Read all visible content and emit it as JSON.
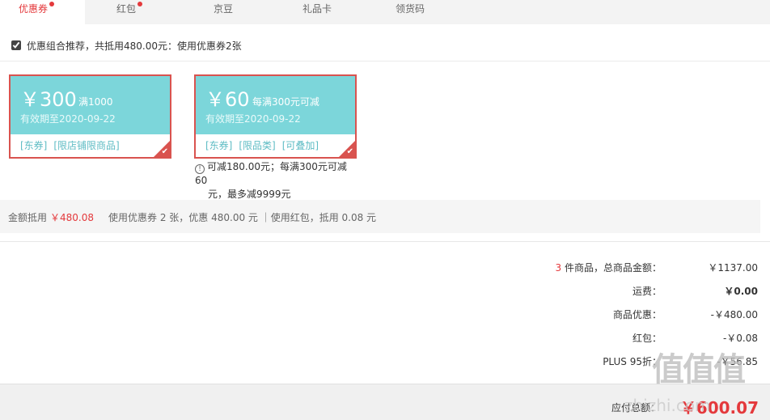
{
  "tabs": [
    {
      "label": "优惠券",
      "active": true,
      "dot": true
    },
    {
      "label": "红包",
      "active": false,
      "dot": true
    },
    {
      "label": "京豆",
      "active": false,
      "dot": false
    },
    {
      "label": "礼品卡",
      "active": false,
      "dot": false
    },
    {
      "label": "领货码",
      "active": false,
      "dot": false
    }
  ],
  "combo": {
    "label": "优惠组合推荐，共抵用480.00元：使用优惠券2张",
    "checked": true
  },
  "coupons": [
    {
      "amount": "￥300",
      "condition": "满1000",
      "validity": "有效期至2020-09-22",
      "tags": [
        "[东券]",
        "[限店铺限商品]"
      ]
    },
    {
      "amount": "￥60",
      "condition": "每满300元可减",
      "validity": "有效期至2020-09-22",
      "tags": [
        "[东券]",
        "[限品类]",
        "[可叠加]"
      ]
    }
  ],
  "coupon_note": {
    "line1": "可减180.00元；每满300元可减60",
    "line2": "元，最多减9999元"
  },
  "summary": {
    "label": "金额抵用",
    "amount": "￥480.08",
    "detail": "使用优惠券 2 张，优惠 480.00 元 ｜使用红包，抵用 0.08 元"
  },
  "totals": {
    "items_count": "3",
    "items_label": " 件商品，总商品金额：",
    "items_value": "￥1137.00",
    "shipping_label": "运费：",
    "shipping_value": "￥0.00",
    "discount_label": "商品优惠：",
    "discount_value": "-￥480.00",
    "redpacket_label": "红包：",
    "redpacket_value": "-￥0.08",
    "plus_label": "PLUS 95折：",
    "plus_value": "-￥56.85",
    "pay_label": "应付总额：",
    "pay_value": "￥600.07"
  },
  "watermark": {
    "icons": "值值值",
    "text": "zhizhi.com"
  },
  "colors": {
    "accent": "#e4393c",
    "coupon_bg": "#7cd6da",
    "coupon_border": "#d9534f",
    "tag": "#5fbcc4"
  }
}
